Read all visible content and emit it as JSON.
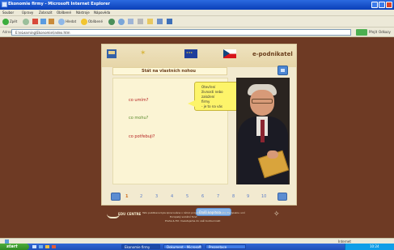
{
  "window": {
    "title": "Ekonomie firmy - Microsoft Internet Explorer"
  },
  "menubar": {
    "items": [
      "Soubor",
      "Úpravy",
      "Zobrazit",
      "Oblíbené",
      "Nástroje",
      "Nápověda"
    ]
  },
  "toolbar": {
    "back_label": "Zpět",
    "search_label": "Hledat",
    "favorites_label": "Oblíbené"
  },
  "addressbar": {
    "label": "Adresa",
    "url": "E:\\eLearning\\Ekonomie\\index.htm",
    "go_label": "Přejít",
    "links_label": "Odkazy"
  },
  "course": {
    "brand": "e-podnikatel",
    "lesson_title": "Stát na vlastních nohou",
    "items": [
      "co umím?",
      "co mohu?",
      "co potřebuji?"
    ],
    "tooltip_lines": [
      "Otevření",
      "živnosti nebo",
      "založení",
      "firmy",
      "- je to na vás"
    ],
    "next_label": "Další kapitola"
  },
  "pager": {
    "pages": [
      "1",
      "2",
      "3",
      "4",
      "5",
      "6",
      "7",
      "8",
      "9",
      "10"
    ],
    "current": "1"
  },
  "footer": {
    "logo_text": "EDU CENTRE",
    "lines": [
      "Tato publikace byla zpracována v rámci projektu spolufinancovaného Evropskou unií",
      "Evropský sociální fond",
      "Praha & EU: Investujeme do vaší budoucnosti"
    ]
  },
  "statusbar": {
    "zone": "Internet"
  },
  "taskbar": {
    "start_label": "start",
    "tasks": [
      "Ekonomie firmy",
      "Dokument - Microsoft",
      "Prezentace"
    ],
    "clock": "10:24"
  }
}
